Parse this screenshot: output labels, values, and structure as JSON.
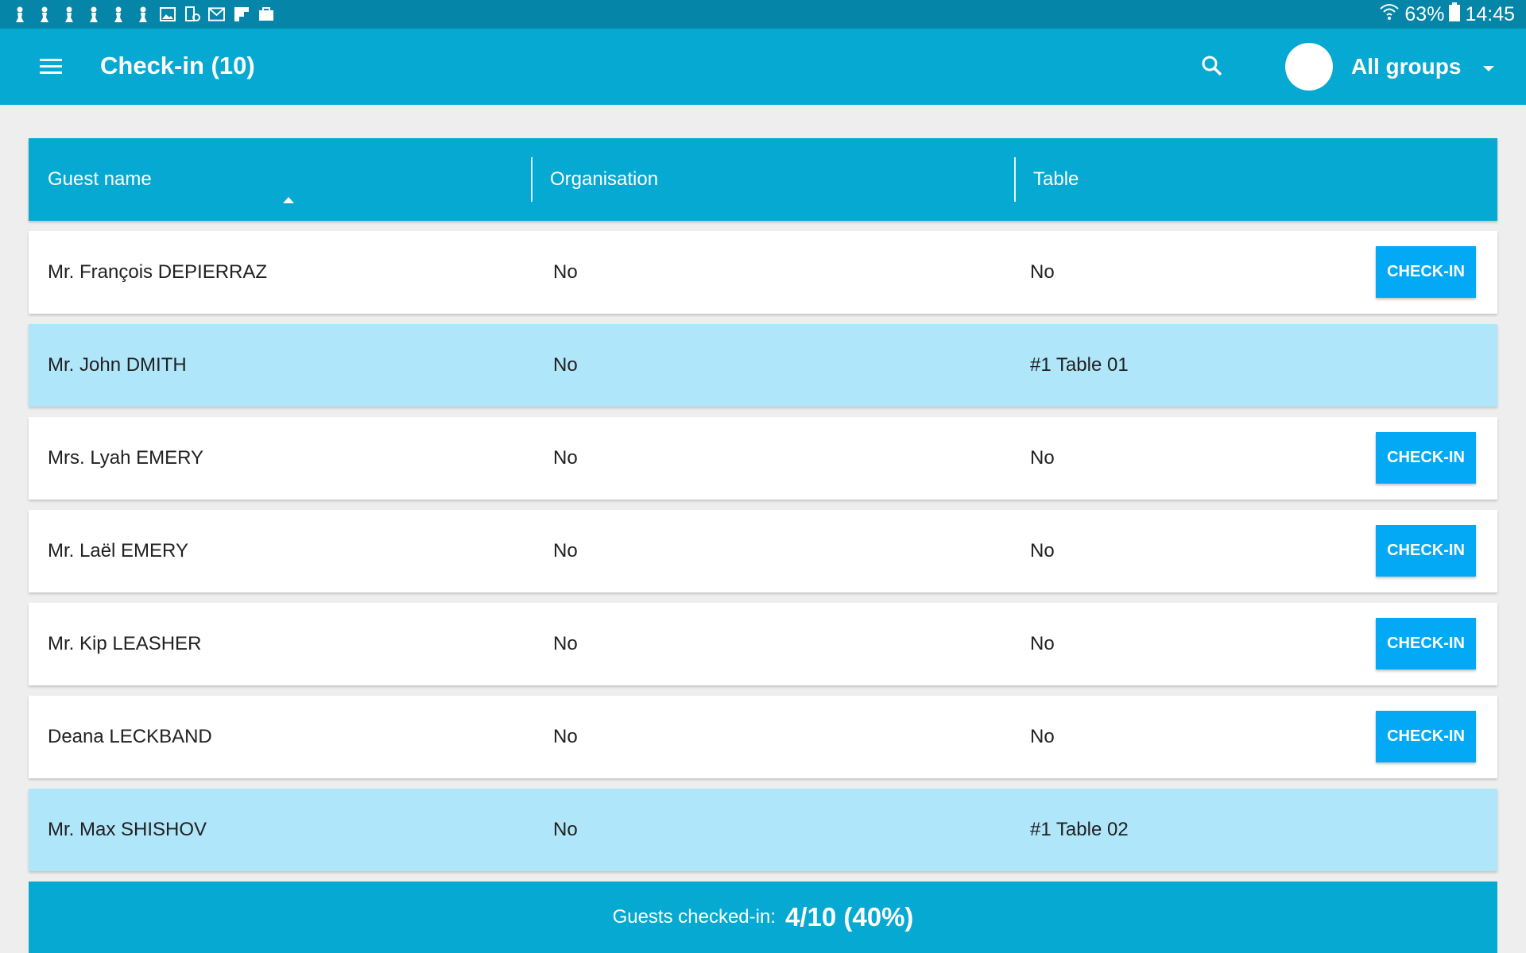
{
  "status_bar": {
    "notification_icons": [
      "pawn-icon",
      "pawn-icon",
      "pawn-icon",
      "pawn-icon",
      "pawn-icon",
      "pawn-icon",
      "image-icon",
      "phone-icon",
      "mail-icon",
      "flipboard-icon",
      "briefcase-icon"
    ],
    "battery": "63%",
    "time": "14:45"
  },
  "app_bar": {
    "title": "Check-in (10)",
    "group_selector": "All groups"
  },
  "table": {
    "headers": {
      "name": "Guest name",
      "organisation": "Organisation",
      "table": "Table"
    },
    "rows": [
      {
        "name": "Mr. François DEPIERRAZ",
        "organisation": "No",
        "table": "No",
        "checked_in": false,
        "button": "CHECK-IN"
      },
      {
        "name": "Mr. John DMITH",
        "organisation": "No",
        "table": "#1 Table 01",
        "checked_in": true,
        "button": ""
      },
      {
        "name": "Mrs. Lyah EMERY",
        "organisation": "No",
        "table": "No",
        "checked_in": false,
        "button": "CHECK-IN"
      },
      {
        "name": "Mr. Laël EMERY",
        "organisation": "No",
        "table": "No",
        "checked_in": false,
        "button": "CHECK-IN"
      },
      {
        "name": "Mr. Kip LEASHER",
        "organisation": "No",
        "table": "No",
        "checked_in": false,
        "button": "CHECK-IN"
      },
      {
        "name": "Deana LECKBAND",
        "organisation": "No",
        "table": "No",
        "checked_in": false,
        "button": "CHECK-IN"
      },
      {
        "name": "Mr. Max SHISHOV",
        "organisation": "No",
        "table": "#1 Table 02",
        "checked_in": true,
        "button": ""
      }
    ]
  },
  "footer": {
    "label": "Guests checked-in:",
    "value": "4/10 (40%)"
  },
  "colors": {
    "status_bar": "#0586a8",
    "primary": "#06a9d2",
    "button": "#03a9f4",
    "checked_row": "#b0e6fa",
    "background": "#eeeeee"
  }
}
